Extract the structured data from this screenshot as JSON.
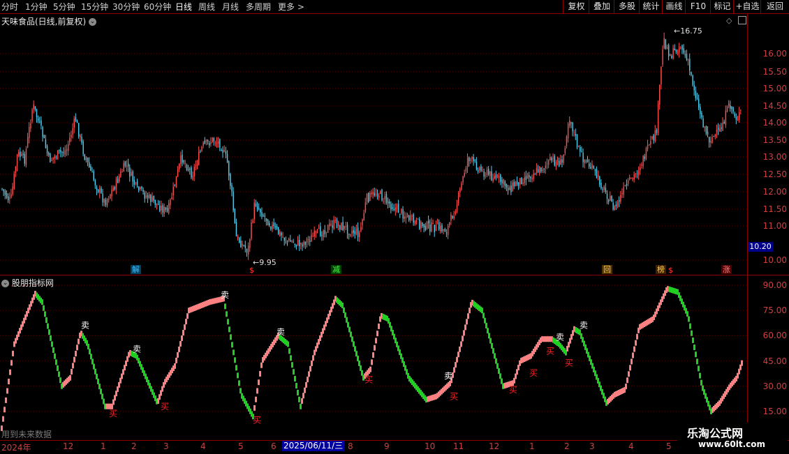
{
  "toolbar": {
    "periods": [
      "分时",
      "1分钟",
      "5分钟",
      "15分钟",
      "30分钟",
      "60分钟",
      "日线",
      "周线",
      "月线",
      "多周期",
      "更多 >"
    ],
    "active": "日线",
    "right_buttons": [
      "复权",
      "叠加",
      "多股",
      "统计",
      "画线",
      "F10",
      "标记",
      "+自选",
      "返回"
    ]
  },
  "main": {
    "title": "天味食品(日线,前复权)",
    "high_label": "16.75",
    "low_label": "9.95",
    "current_price": "10.20",
    "yticks": [
      "16.00",
      "15.50",
      "15.00",
      "14.50",
      "14.00",
      "13.50",
      "13.00",
      "12.50",
      "12.00",
      "11.50",
      "11.00",
      "10.00"
    ],
    "badges": [
      {
        "text": "解",
        "color": "#40c0ff",
        "bg": "#004060"
      },
      {
        "text": "$",
        "color": "#ff3030",
        "bg": "#000000"
      },
      {
        "text": "减",
        "color": "#40ff40",
        "bg": "#004000"
      },
      {
        "text": "回",
        "color": "#ffd040",
        "bg": "#503000"
      },
      {
        "text": "榜",
        "color": "#ffd040",
        "bg": "#402000"
      },
      {
        "text": "$",
        "color": "#ff3030",
        "bg": "#000000"
      },
      {
        "text": "涨",
        "color": "#ff8080",
        "bg": "#500000"
      }
    ]
  },
  "indicator": {
    "title": "股朋指标网",
    "yticks": [
      "90.00",
      "75.00",
      "60.00",
      "45.00",
      "30.00",
      "15.00"
    ],
    "sell_label": "卖",
    "buy_label": "买",
    "future_note": "用到未来数据"
  },
  "xaxis": {
    "labels": [
      "2024年",
      "12",
      "1",
      "2",
      "3",
      "4",
      "5",
      "6",
      "8",
      "9",
      "10",
      "11",
      "12",
      "1",
      "2",
      "3",
      "4",
      "5"
    ],
    "cursor_date": "2025/06/11/三"
  },
  "watermark": {
    "line1": "乐淘公式网",
    "line2": "www.60lt.com"
  },
  "colors": {
    "up": "#ff5050",
    "down": "#50d0f0",
    "osc_up": "#ff8080",
    "osc_down": "#20d020",
    "grid": "#5a0000",
    "border": "#8b0000"
  }
}
